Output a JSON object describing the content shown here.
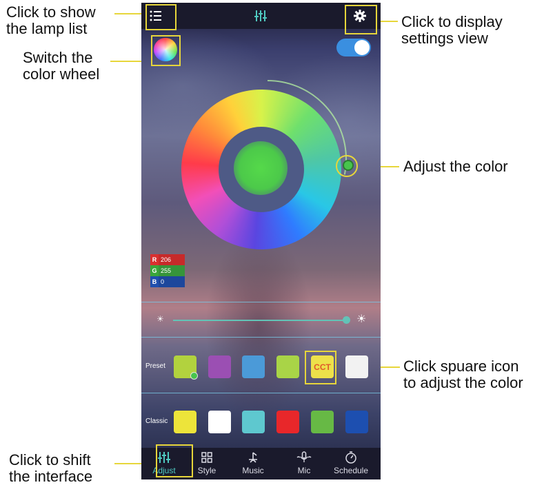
{
  "annotations": {
    "lamp_list": "Click to show\nthe lamp list",
    "color_wheel": "Switch the\ncolor wheel",
    "settings": "Click to display\nsettings view",
    "adjust_color": "Adjust the color",
    "square_icon": "Click spuare icon\nto adjust the color",
    "shift_interface": "Click to shift\nthe interface"
  },
  "rgb": {
    "r_key": "R",
    "r_value": "206",
    "g_key": "G",
    "g_value": "255",
    "b_key": "B",
    "b_value": "0"
  },
  "colors": {
    "accent": "#4fc9c0",
    "highlight": "#e7d63a"
  },
  "preset": {
    "label": "Preset",
    "swatches": [
      "#b2d23e",
      "#9b4fb3",
      "#4b9ad8",
      "#a9d447",
      "#ede14a",
      "#f2f2f2"
    ],
    "cct_label": "CCT"
  },
  "classic": {
    "label": "Classic",
    "swatches": [
      "#ede43a",
      "#ffffff",
      "#5ec8cf",
      "#e8272a",
      "#67b945",
      "#1d4fb0"
    ]
  },
  "tabs": [
    {
      "label": "Adjust",
      "icon": "sliders-icon"
    },
    {
      "label": "Style",
      "icon": "grid-icon"
    },
    {
      "label": "Music",
      "icon": "music-icon"
    },
    {
      "label": "Mic",
      "icon": "mic-icon"
    },
    {
      "label": "Schedule",
      "icon": "timer-icon"
    }
  ],
  "toggle_on": true
}
